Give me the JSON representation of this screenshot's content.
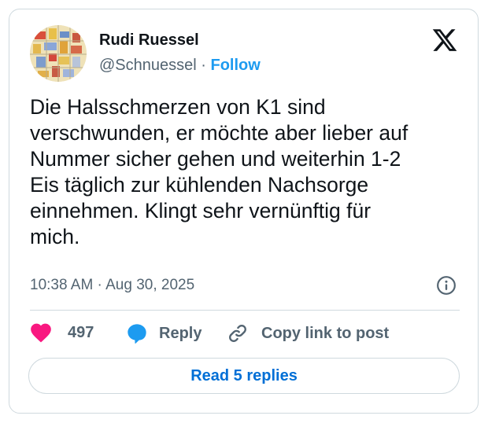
{
  "author": {
    "name": "Rudi Ruessel",
    "handle": "@Schnuessel",
    "separator": "·",
    "follow_label": "Follow"
  },
  "tweet": {
    "text": "Die Halsschmerzen von K1 sind\nverschwunden, er möchte aber lieber auf\nNummer sicher gehen und weiterhin 1-2\nEis täglich zur kühlenden Nachsorge\neinnehmen. Klingt sehr vernünftig für\nmich.",
    "timestamp": "10:38 AM · Aug 30, 2025"
  },
  "actions": {
    "likes_count": "497",
    "reply_label": "Reply",
    "copy_link_label": "Copy link to post"
  },
  "footer": {
    "read_replies_label": "Read 5 replies"
  },
  "icons": {
    "x_logo": "x-logo-icon",
    "info": "info-icon",
    "heart": "heart-icon",
    "reply": "reply-bubble-icon",
    "link": "link-icon"
  },
  "colors": {
    "like": "#f91880",
    "reply": "#1d9bf0",
    "follow": "#1d9bf0",
    "read_replies": "#006fd6",
    "secondary_text": "#536471"
  }
}
